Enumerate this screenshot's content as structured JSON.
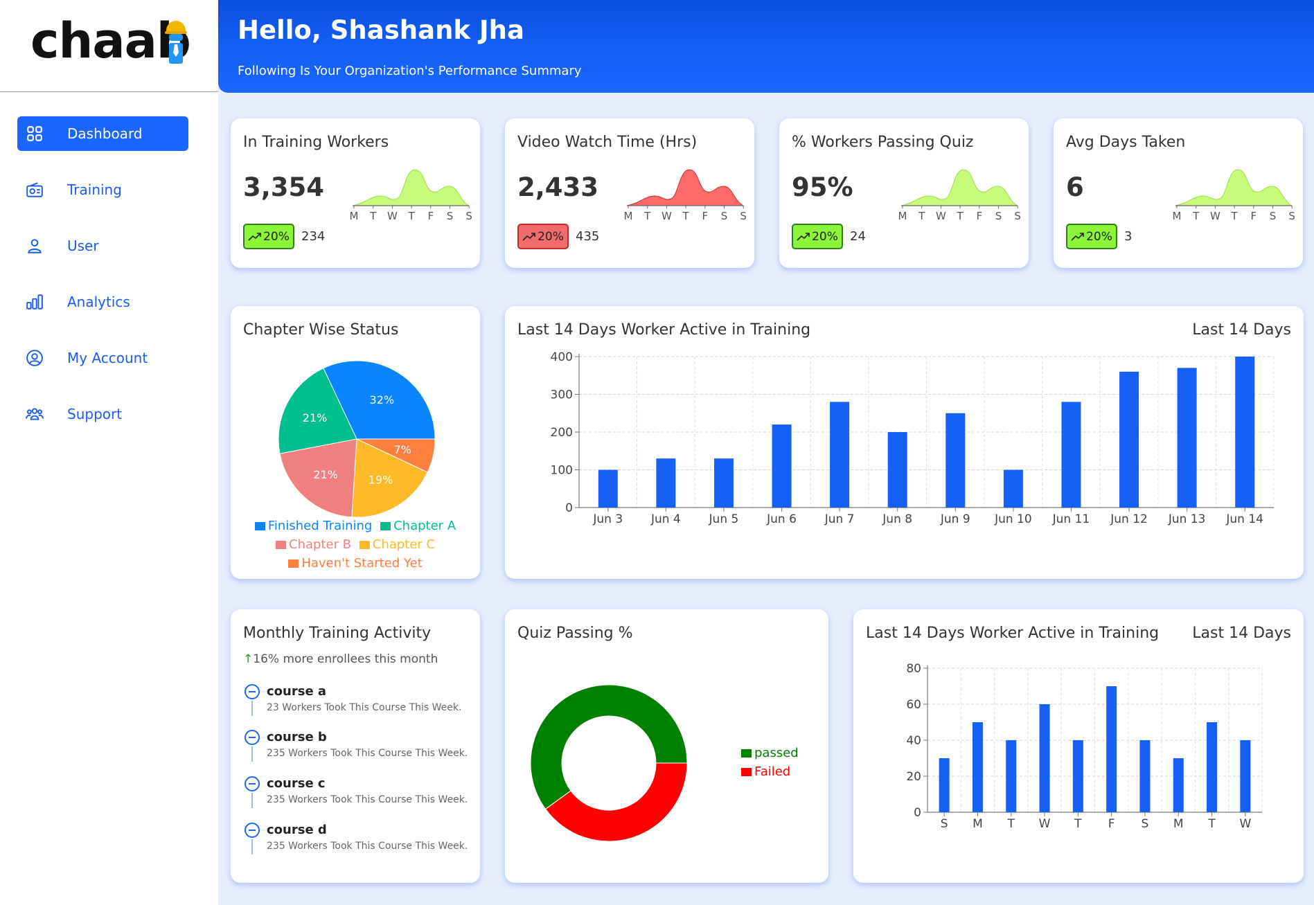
{
  "brand": {
    "logo_text": "chaab",
    "accent": "#1a66ff"
  },
  "sidebar": {
    "items": [
      {
        "label": "Dashboard",
        "icon": "grid-icon",
        "active": true
      },
      {
        "label": "Training",
        "icon": "radio-icon",
        "active": false
      },
      {
        "label": "User",
        "icon": "user-icon",
        "active": false
      },
      {
        "label": "Analytics",
        "icon": "bar-chart-icon",
        "active": false
      },
      {
        "label": "My Account",
        "icon": "account-circle-icon",
        "active": false
      },
      {
        "label": "Support",
        "icon": "group-icon",
        "active": false
      }
    ]
  },
  "header": {
    "greeting": "Hello, Shashank Jha",
    "subtitle": "Following Is Your Organization's Performance Summary"
  },
  "kpis": [
    {
      "title": "In Training Workers",
      "value": "3,354",
      "change": "20%",
      "trend": "up",
      "status": "green",
      "count": "234",
      "spark_color": "#c8fb7a",
      "spark_stroke": "#9fdc47",
      "days": [
        "M",
        "T",
        "W",
        "T",
        "F",
        "S",
        "S"
      ]
    },
    {
      "title": "Video Watch Time (Hrs)",
      "value": "2,433",
      "change": "20%",
      "trend": "up",
      "status": "red",
      "count": "435",
      "spark_color": "#ff6b6b",
      "spark_stroke": "#cc2a2a",
      "days": [
        "M",
        "T",
        "W",
        "T",
        "F",
        "S",
        "S"
      ]
    },
    {
      "title": "% Workers Passing Quiz",
      "value": "95%",
      "change": "20%",
      "trend": "up",
      "status": "green",
      "count": "24",
      "spark_color": "#c8fb7a",
      "spark_stroke": "#9fdc47",
      "days": [
        "M",
        "T",
        "W",
        "T",
        "F",
        "S",
        "S"
      ]
    },
    {
      "title": "Avg Days Taken",
      "value": "6",
      "change": "20%",
      "trend": "up",
      "status": "green",
      "count": "3",
      "spark_color": "#c8fb7a",
      "spark_stroke": "#9fdc47",
      "days": [
        "M",
        "T",
        "W",
        "T",
        "F",
        "S",
        "S"
      ]
    }
  ],
  "chapter_status": {
    "title": "Chapter Wise Status",
    "legend": [
      {
        "label": "Finished Training",
        "color": "#0a84ff"
      },
      {
        "label": "Chapter A",
        "color": "#00bf8f"
      },
      {
        "label": "Chapter B",
        "color": "#f08080"
      },
      {
        "label": "Chapter C",
        "color": "#ffba2a"
      },
      {
        "label": "Haven't Started Yet",
        "color": "#ff7f3f"
      }
    ]
  },
  "active_14": {
    "title": "Last 14 Days Worker Active in Training",
    "range_label": "Last 14 Days"
  },
  "monthly": {
    "title": "Monthly Training Activity",
    "trend_text": "16% more enrollees this month",
    "courses": [
      {
        "name": "course a",
        "desc": "23 Workers Took This Course This Week."
      },
      {
        "name": "course b",
        "desc": "235 Workers Took This Course This Week."
      },
      {
        "name": "course c",
        "desc": "235 Workers Took This Course This Week."
      },
      {
        "name": "course d",
        "desc": "235 Workers Took This Course This Week."
      }
    ]
  },
  "quiz": {
    "title": "Quiz Passing %",
    "legend": [
      {
        "label": "passed",
        "color": "#008000"
      },
      {
        "label": "Failed",
        "color": "#ff0000"
      }
    ]
  },
  "active_week": {
    "title": "Last 14 Days Worker Active in Training",
    "range_label": "Last 14 Days"
  },
  "chart_data": [
    {
      "type": "pie",
      "title": "Chapter Wise Status",
      "categories": [
        "Finished Training",
        "Chapter A",
        "Chapter B",
        "Chapter C",
        "Haven't Started Yet"
      ],
      "values": [
        32,
        21,
        21,
        19,
        7
      ],
      "labels": [
        "32%",
        "21%",
        "21%",
        "19%",
        "7%"
      ],
      "colors": [
        "#0a84ff",
        "#00bf8f",
        "#f08080",
        "#ffba2a",
        "#ff7f3f"
      ],
      "legend": "bottom"
    },
    {
      "type": "bar",
      "title": "Last 14 Days Worker Active in Training",
      "categories": [
        "Jun 3",
        "Jun 4",
        "Jun 5",
        "Jun 6",
        "Jun 7",
        "Jun 8",
        "Jun 9",
        "Jun 10",
        "Jun 11",
        "Jun 12",
        "Jun 13",
        "Jun 14"
      ],
      "values": [
        100,
        130,
        130,
        220,
        280,
        200,
        250,
        100,
        280,
        360,
        370,
        400
      ],
      "ylim": [
        0,
        400
      ],
      "yticks": [
        0,
        100,
        200,
        300,
        400
      ],
      "grid": true,
      "color": "#1560f5"
    },
    {
      "type": "pie",
      "title": "Quiz Passing %",
      "categories": [
        "passed",
        "Failed"
      ],
      "values": [
        60,
        40
      ],
      "colors": [
        "#008000",
        "#ff0000"
      ],
      "legend": "right"
    },
    {
      "type": "bar",
      "title": "Last 14 Days Worker Active in Training",
      "categories": [
        "S",
        "M",
        "T",
        "W",
        "T",
        "F",
        "S",
        "M",
        "T",
        "W"
      ],
      "values": [
        30,
        50,
        40,
        60,
        40,
        70,
        40,
        30,
        50,
        40
      ],
      "ylim": [
        0,
        80
      ],
      "yticks": [
        0,
        20,
        40,
        60,
        80
      ],
      "grid": true,
      "color": "#1560f5"
    }
  ]
}
